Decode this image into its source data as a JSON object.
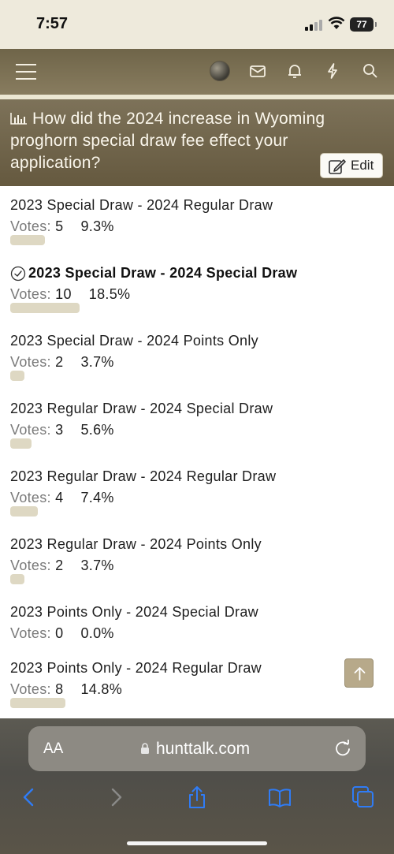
{
  "status": {
    "time": "7:57",
    "battery": "77"
  },
  "nav": {
    "icons": [
      "menu-icon",
      "avatar",
      "envelope-icon",
      "bell-icon",
      "bolt-icon",
      "search-icon"
    ]
  },
  "poll": {
    "title": "How did the 2024 increase in Wyoming proghorn special draw fee effect your application?",
    "edit_label": "Edit",
    "votes_label": "Votes:",
    "options": [
      {
        "label": "2023 Special Draw - 2024 Regular Draw",
        "votes": "5",
        "percent": "9.3%",
        "share": 0.093,
        "voted": false
      },
      {
        "label": "2023 Special Draw - 2024 Special Draw",
        "votes": "10",
        "percent": "18.5%",
        "share": 0.185,
        "voted": true
      },
      {
        "label": "2023 Special Draw - 2024 Points Only",
        "votes": "2",
        "percent": "3.7%",
        "share": 0.037,
        "voted": false
      },
      {
        "label": "2023 Regular Draw - 2024 Special Draw",
        "votes": "3",
        "percent": "5.6%",
        "share": 0.056,
        "voted": false
      },
      {
        "label": "2023 Regular Draw - 2024 Regular Draw",
        "votes": "4",
        "percent": "7.4%",
        "share": 0.074,
        "voted": false
      },
      {
        "label": "2023 Regular Draw - 2024 Points Only",
        "votes": "2",
        "percent": "3.7%",
        "share": 0.037,
        "voted": false
      },
      {
        "label": "2023 Points Only - 2024 Special Draw",
        "votes": "0",
        "percent": "0.0%",
        "share": 0.0,
        "voted": false
      },
      {
        "label": "2023 Points Only - 2024 Regular Draw",
        "votes": "8",
        "percent": "14.8%",
        "share": 0.148,
        "voted": false
      }
    ]
  },
  "browser": {
    "aa_label": "AA",
    "url": "hunttalk.com",
    "toolbar": [
      "back-icon",
      "forward-icon",
      "share-icon",
      "bookmarks-icon",
      "tabs-icon"
    ]
  },
  "colors": {
    "accent": "#6f6549",
    "bar": "#ded8c3",
    "ios_blue": "#2f7cf6"
  }
}
